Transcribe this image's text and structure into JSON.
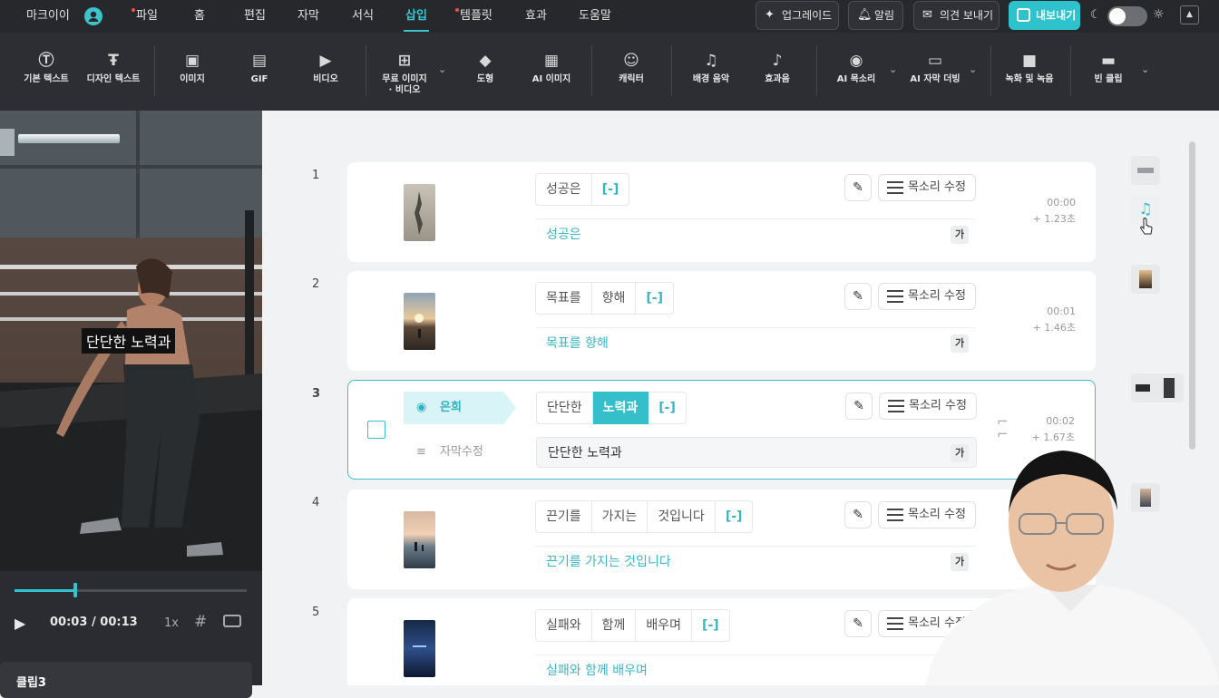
{
  "menubar": {
    "brand": "마크이이",
    "items": [
      "파일",
      "홈",
      "편집",
      "자막",
      "서식",
      "삽입",
      "템플릿",
      "효과",
      "도움말"
    ],
    "active": "삽입",
    "upgrade": "업그레이드",
    "notify": "알림",
    "feedback": "의견 보내기",
    "export": "내보내기"
  },
  "toolbar": {
    "items": [
      "기본 텍스트",
      "디자인 텍스트",
      "이미지",
      "GIF",
      "비디오",
      "무료 이미지",
      "· 비디오",
      "도형",
      "AI 이미지",
      "캐릭터",
      "배경 음악",
      "효과음",
      "AI 목소리",
      "AI 자막 더빙",
      "녹화 및 녹음",
      "빈 클립"
    ]
  },
  "preview": {
    "subtitle": "단단한 노력과",
    "current_time": "00:03",
    "total_time": "/ 00:13",
    "speed": "1x",
    "progress": 0.26,
    "clip_label": "클립3"
  },
  "rows": [
    {
      "num": "1",
      "words": [
        "성공은",
        "[-]"
      ],
      "caption": "성공은",
      "time": "00:00",
      "dur": "+ 1.23초"
    },
    {
      "num": "2",
      "words": [
        "목표를",
        "향해",
        "[-]"
      ],
      "caption": "목표를 향해",
      "time": "00:01",
      "dur": "+ 1.46초"
    },
    {
      "num": "3",
      "words": [
        "단단한",
        "노력과",
        "[-]"
      ],
      "caption": "단단한 노력과",
      "time": "00:02",
      "dur": "+ 1.67초",
      "speaker": "은희",
      "edit_label": "자막수정"
    },
    {
      "num": "4",
      "words": [
        "끈기를",
        "가지는",
        "것입니다",
        "[-]"
      ],
      "caption": "끈기를 가지는 것입니다",
      "time": "",
      "dur": ""
    },
    {
      "num": "5",
      "words": [
        "실패와",
        "함께",
        "배우며",
        "[-]"
      ],
      "caption": "실패와 함께 배우며",
      "time": "",
      "dur": ""
    }
  ],
  "common": {
    "voice_edit": "목소리 수정",
    "ga": "가"
  },
  "colors": {
    "accent": "#34bfcb",
    "menubar": "#26282c",
    "toolbar": "#2c2e33"
  }
}
